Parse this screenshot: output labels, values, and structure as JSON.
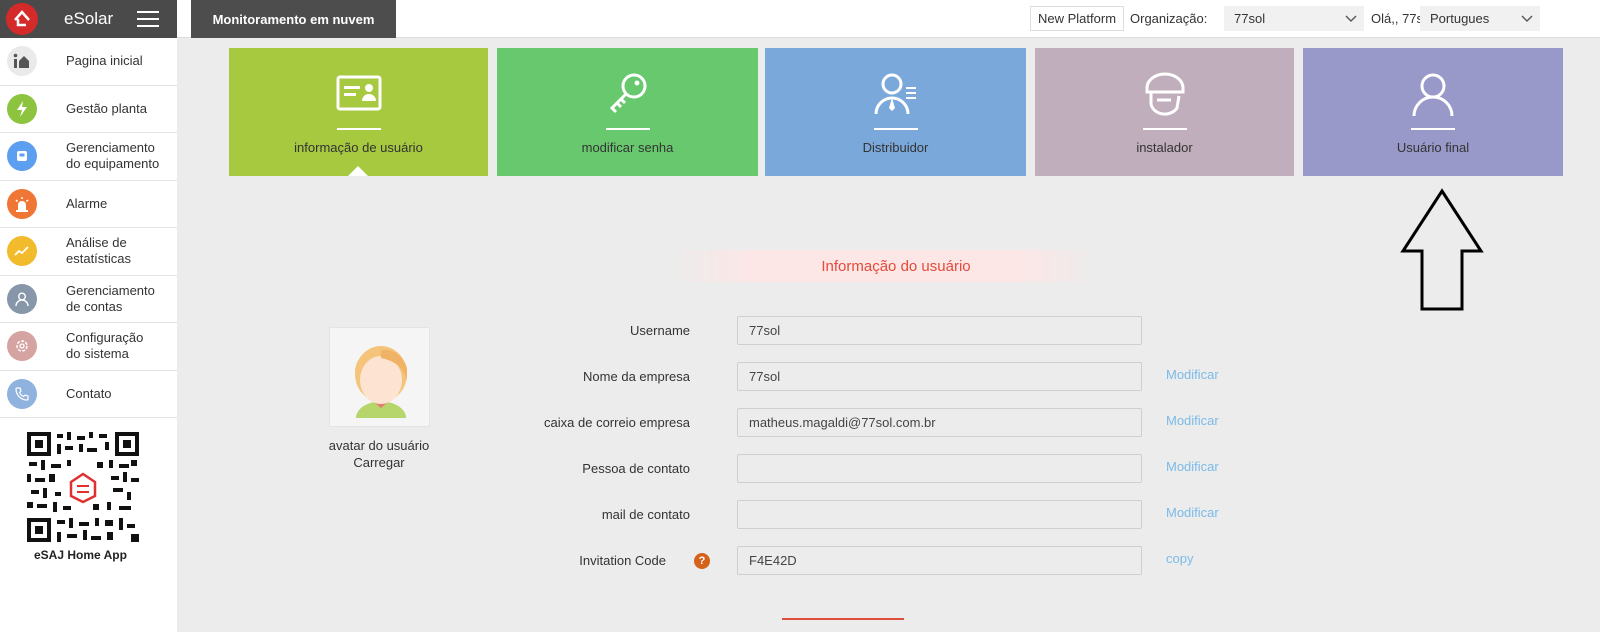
{
  "brand": {
    "name": "eSolar"
  },
  "sidebar": {
    "items": [
      {
        "label": "Pagina inicial",
        "icon": "home-icon",
        "color": "#eaeaea"
      },
      {
        "label": "Gestão planta",
        "icon": "lightning-icon",
        "color": "#8dc43f"
      },
      {
        "label": "Gerenciamento do equipamento",
        "icon": "device-icon",
        "color": "#5c9ef0"
      },
      {
        "label": "Alarme",
        "icon": "alarm-icon",
        "color": "#f07636"
      },
      {
        "label": "Análise de estatísticas",
        "icon": "stats-icon",
        "color": "#f2bb2c"
      },
      {
        "label": "Gerenciamento de contas",
        "icon": "account-icon",
        "color": "#8796a8"
      },
      {
        "label": "Configuração do sistema",
        "icon": "settings-icon",
        "color": "#d6a3a3"
      },
      {
        "label": "Contato",
        "icon": "phone-icon",
        "color": "#8fb3de"
      }
    ],
    "qr_label": "eSAJ Home App"
  },
  "topbar": {
    "cloud_tab": "Monitoramento em nuvem",
    "new_platform": "New Platform",
    "org_label": "Organização:",
    "org_value": "77sol",
    "hello": "Olá,, 77sol",
    "lang_value": "Portugues"
  },
  "tiles": [
    {
      "label": "informação de usuário",
      "icon": "id-card-icon",
      "color": "#a6c940"
    },
    {
      "label": "modificar senha",
      "icon": "key-icon",
      "color": "#68c86e"
    },
    {
      "label": "Distribuidor",
      "icon": "distributor-icon",
      "color": "#7aa8db"
    },
    {
      "label": "instalador",
      "icon": "installer-icon",
      "color": "#c1aebd"
    },
    {
      "label": "Usuário final",
      "icon": "end-user-icon",
      "color": "#9898c9"
    }
  ],
  "section_title": "Informação do usuário",
  "avatar": {
    "label": "avatar do usuário",
    "upload": "Carregar"
  },
  "form": {
    "fields": [
      {
        "label": "Username",
        "value": "77sol",
        "action": ""
      },
      {
        "label": "Nome da empresa",
        "value": "77sol",
        "action": "Modificar"
      },
      {
        "label": "caixa de correio empresa",
        "value": "matheus.magaldi@77sol.com.br",
        "action": "Modificar"
      },
      {
        "label": "Pessoa de contato",
        "value": "",
        "action": "Modificar"
      },
      {
        "label": "mail de contato",
        "value": "",
        "action": "Modificar"
      },
      {
        "label": "Invitation Code",
        "value": "F4E42D",
        "action": "copy"
      }
    ]
  },
  "colors": {
    "accent_red": "#e54a3a",
    "link_blue": "#7bbbe8",
    "dark_bar": "#4a4a4a"
  }
}
